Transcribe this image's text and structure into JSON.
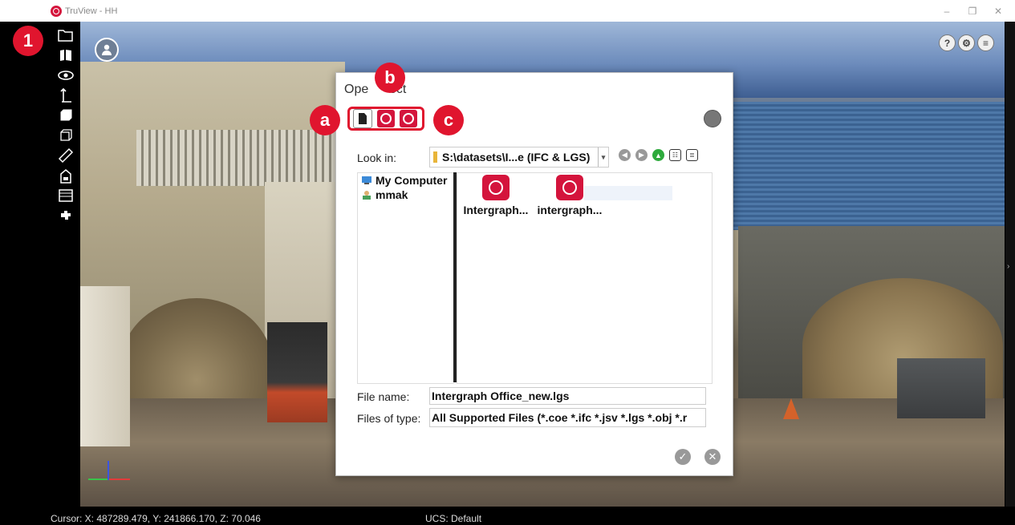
{
  "window": {
    "title": "TruView - HH",
    "minimize": "–",
    "restore": "❐",
    "close": "✕"
  },
  "toolbar": {
    "items": [
      {
        "glyph": "🗁"
      },
      {
        "glyph": "◧"
      },
      {
        "glyph": "👁"
      },
      {
        "glyph": "↧"
      },
      {
        "glyph": "▦"
      },
      {
        "glyph": "⬚"
      },
      {
        "glyph": "📏"
      },
      {
        "glyph": "🏢"
      },
      {
        "glyph": "▤"
      },
      {
        "glyph": "✚"
      }
    ]
  },
  "viewer": {
    "help_glyph": "?",
    "settings_glyph": "⚙",
    "info_glyph": "≡",
    "side_arrow": "›"
  },
  "status": {
    "cursor": "Cursor: X: 487289.479, Y: 241866.170, Z: 70.046",
    "ucs": "UCS: Default"
  },
  "dialog": {
    "title_left": "Ope",
    "title_right": "ect",
    "look_in_label": "Look in:",
    "look_in_value": "S:\\datasets\\I...e (IFC & LGS)",
    "nav": {
      "back": "◀",
      "forward": "▶",
      "up": "▲",
      "list_view": "☷",
      "detail_view": "≣"
    },
    "places": [
      {
        "label": "My Computer",
        "icon": "computer-icon"
      },
      {
        "label": "mmak",
        "icon": "user-folder-icon"
      }
    ],
    "files": [
      {
        "label": "Intergraph...",
        "icon": "truview-project-icon"
      },
      {
        "label": "intergraph...",
        "icon": "ifc-project-icon"
      }
    ],
    "file_name_label": "File name:",
    "file_name_value": "Intergraph Office_new.lgs",
    "file_type_label": "Files of type:",
    "file_type_value": "All Supported Files (*.coe *.ifc *.jsv *.lgs *.obj *.r",
    "ok_glyph": "✓",
    "cancel_glyph": "✕"
  },
  "callouts": {
    "one": "1",
    "a": "a",
    "b": "b",
    "c": "c"
  },
  "colors": {
    "accent_red": "#e0152e",
    "brand_red": "#d4143c"
  }
}
